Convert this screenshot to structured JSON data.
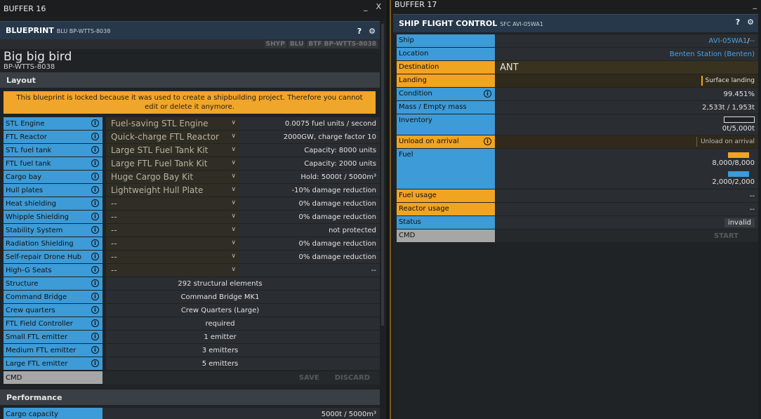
{
  "buffer16": {
    "title": "BUFFER 16",
    "min_label": "_",
    "close_label": "X",
    "panel_title": "BLUEPRINT",
    "panel_sub": "BLU BP-WTTS-8038",
    "help": "?",
    "settings": "⚙",
    "tags": [
      "SHYP",
      "BLU",
      "BTF BP-WTTS-8038"
    ],
    "bp_name": "Big big bird",
    "bp_code": "BP-WTTS-8038",
    "layout_header": "Layout",
    "warning": "This blueprint is locked because it was used to create a shipbuilding project. Therefore you cannot edit or delete it anymore.",
    "select_rows": [
      {
        "label": "STL Engine",
        "select": "Fuel-saving STL Engine",
        "value": "0.0075 fuel units / second"
      },
      {
        "label": "FTL Reactor",
        "select": "Quick-charge FTL Reactor",
        "value": "2000GW, charge factor 10"
      },
      {
        "label": "STL fuel tank",
        "select": "Large STL Fuel Tank Kit",
        "value": "Capacity: 8000 units"
      },
      {
        "label": "FTL fuel tank",
        "select": "Large FTL Fuel Tank Kit",
        "value": "Capacity: 2000 units"
      },
      {
        "label": "Cargo bay",
        "select": "Huge Cargo Bay Kit",
        "value": "Hold: 5000t / 5000m³"
      },
      {
        "label": "Hull plates",
        "select": "Lightweight Hull Plate",
        "value": "-10% damage reduction"
      },
      {
        "label": "Heat shielding",
        "select": "--",
        "value": "0% damage reduction"
      },
      {
        "label": "Whipple Shielding",
        "select": "--",
        "value": "0% damage reduction"
      },
      {
        "label": "Stability System",
        "select": "--",
        "value": "not protected"
      },
      {
        "label": "Radiation Shielding",
        "select": "--",
        "value": "0% damage reduction"
      },
      {
        "label": "Self-repair Drone Hub",
        "select": "--",
        "value": "0% damage reduction"
      },
      {
        "label": "High-G Seats",
        "select": "--",
        "value": "--"
      }
    ],
    "fixed_rows": [
      {
        "label": "Structure",
        "value": "292 structural elements"
      },
      {
        "label": "Command Bridge",
        "value": "Command Bridge MK1"
      },
      {
        "label": "Crew quarters",
        "value": "Crew Quarters (Large)"
      },
      {
        "label": "FTL Field Controller",
        "value": "required"
      },
      {
        "label": "Small FTL emitter",
        "value": "1 emitter"
      },
      {
        "label": "Medium FTL emitter",
        "value": "3 emitters"
      },
      {
        "label": "Large FTL emitter",
        "value": "5 emitters"
      }
    ],
    "cmd_label": "CMD",
    "save_label": "SAVE",
    "discard_label": "DISCARD",
    "performance_header": "Performance",
    "perf_row": {
      "label": "Cargo capacity",
      "value": "5000t / 5000m³"
    }
  },
  "buffer17": {
    "title": "BUFFER 17",
    "min_label": "_",
    "panel_title": "SHIP FLIGHT CONTROL",
    "panel_sub": "SFC AVI-05WA1",
    "help": "?",
    "settings": "⚙",
    "ship": {
      "label": "Ship",
      "value": "AVI-05WA1",
      "sep": " / ",
      "extra": "--"
    },
    "location": {
      "label": "Location",
      "value": "Benten Station (Benten)"
    },
    "destination": {
      "label": "Destination",
      "value": "ANT"
    },
    "landing": {
      "label": "Landing",
      "value": "Surface landing"
    },
    "condition": {
      "label": "Condition",
      "value": "99.451%"
    },
    "mass": {
      "label": "Mass / Empty mass",
      "value": "2,533t / 1,953t"
    },
    "inventory": {
      "label": "Inventory",
      "value": "0t/5,000t",
      "fill": 0.0
    },
    "unload": {
      "label": "Unload on arrival",
      "value": "Unload on arrival"
    },
    "fuel": {
      "label": "Fuel",
      "stl_value": "8,000/8,000",
      "ftl_value": "2,000/2,000",
      "stl_fill": 1.0,
      "ftl_fill": 1.0,
      "stl_color": "#f0a420",
      "ftl_color": "#3d9bd7"
    },
    "fuel_usage": {
      "label": "Fuel usage",
      "value": "--"
    },
    "reactor_usage": {
      "label": "Reactor usage",
      "value": "--"
    },
    "status": {
      "label": "Status",
      "value": "invalid"
    },
    "cmd_label": "CMD",
    "start_label": "START"
  },
  "colors": {
    "label_blue": "#3d9bd7",
    "label_orange": "#f0a420",
    "warning": "#f0a62a"
  }
}
